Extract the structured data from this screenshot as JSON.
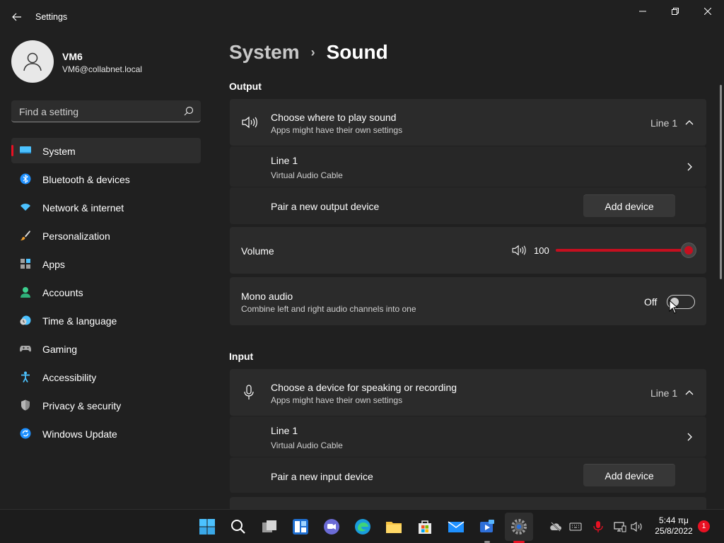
{
  "window": {
    "title": "Settings",
    "back_icon": "back-arrow-icon",
    "minimize_icon": "minimize-icon",
    "maximize_icon": "restore-icon",
    "close_icon": "close-icon"
  },
  "profile": {
    "name": "VM6",
    "email": "VM6@collabnet.local",
    "avatar_icon": "user-avatar-icon"
  },
  "search": {
    "placeholder": "Find a setting",
    "icon": "search-icon"
  },
  "sidebar": {
    "items": [
      {
        "label": "System",
        "icon": "system-icon",
        "selected": true
      },
      {
        "label": "Bluetooth & devices",
        "icon": "bluetooth-icon"
      },
      {
        "label": "Network & internet",
        "icon": "wifi-icon"
      },
      {
        "label": "Personalization",
        "icon": "brush-icon"
      },
      {
        "label": "Apps",
        "icon": "apps-icon"
      },
      {
        "label": "Accounts",
        "icon": "accounts-icon"
      },
      {
        "label": "Time & language",
        "icon": "clock-globe-icon"
      },
      {
        "label": "Gaming",
        "icon": "gamepad-icon"
      },
      {
        "label": "Accessibility",
        "icon": "accessibility-icon"
      },
      {
        "label": "Privacy & security",
        "icon": "shield-icon"
      },
      {
        "label": "Windows Update",
        "icon": "update-icon"
      }
    ]
  },
  "breadcrumb": {
    "parent": "System",
    "separator": "›",
    "current": "Sound"
  },
  "output": {
    "section_title": "Output",
    "choose": {
      "title": "Choose where to play sound",
      "subtitle": "Apps might have their own settings",
      "value": "Line 1",
      "icon": "speaker-icon"
    },
    "device": {
      "title": "Line 1",
      "subtitle": "Virtual Audio Cable"
    },
    "pair": {
      "title": "Pair a new output device",
      "button": "Add device"
    },
    "volume": {
      "label": "Volume",
      "value": "100",
      "percent": 100,
      "icon": "speaker-icon"
    },
    "mono": {
      "title": "Mono audio",
      "subtitle": "Combine left and right audio channels into one",
      "state": "Off"
    }
  },
  "input": {
    "section_title": "Input",
    "choose": {
      "title": "Choose a device for speaking or recording",
      "subtitle": "Apps might have their own settings",
      "value": "Line 1",
      "icon": "microphone-icon"
    },
    "device": {
      "title": "Line 1",
      "subtitle": "Virtual Audio Cable"
    },
    "pair": {
      "title": "Pair a new input device",
      "button": "Add device"
    }
  },
  "taskbar": {
    "clock_time": "5:44 πμ",
    "clock_date": "25/8/2022",
    "notification_count": "1",
    "apps": [
      "start-icon",
      "search-icon",
      "task-view-icon",
      "widgets-icon",
      "chat-icon",
      "edge-icon",
      "file-explorer-icon",
      "store-icon",
      "mail-icon",
      "media-player-icon",
      "settings-icon"
    ],
    "tray": [
      "onedrive-icon",
      "keyboard-icon",
      "microphone-icon",
      "network-icon",
      "volume-icon"
    ]
  },
  "colors": {
    "accent": "#c50f1f",
    "background": "#202020",
    "card": "#2b2b2b"
  }
}
